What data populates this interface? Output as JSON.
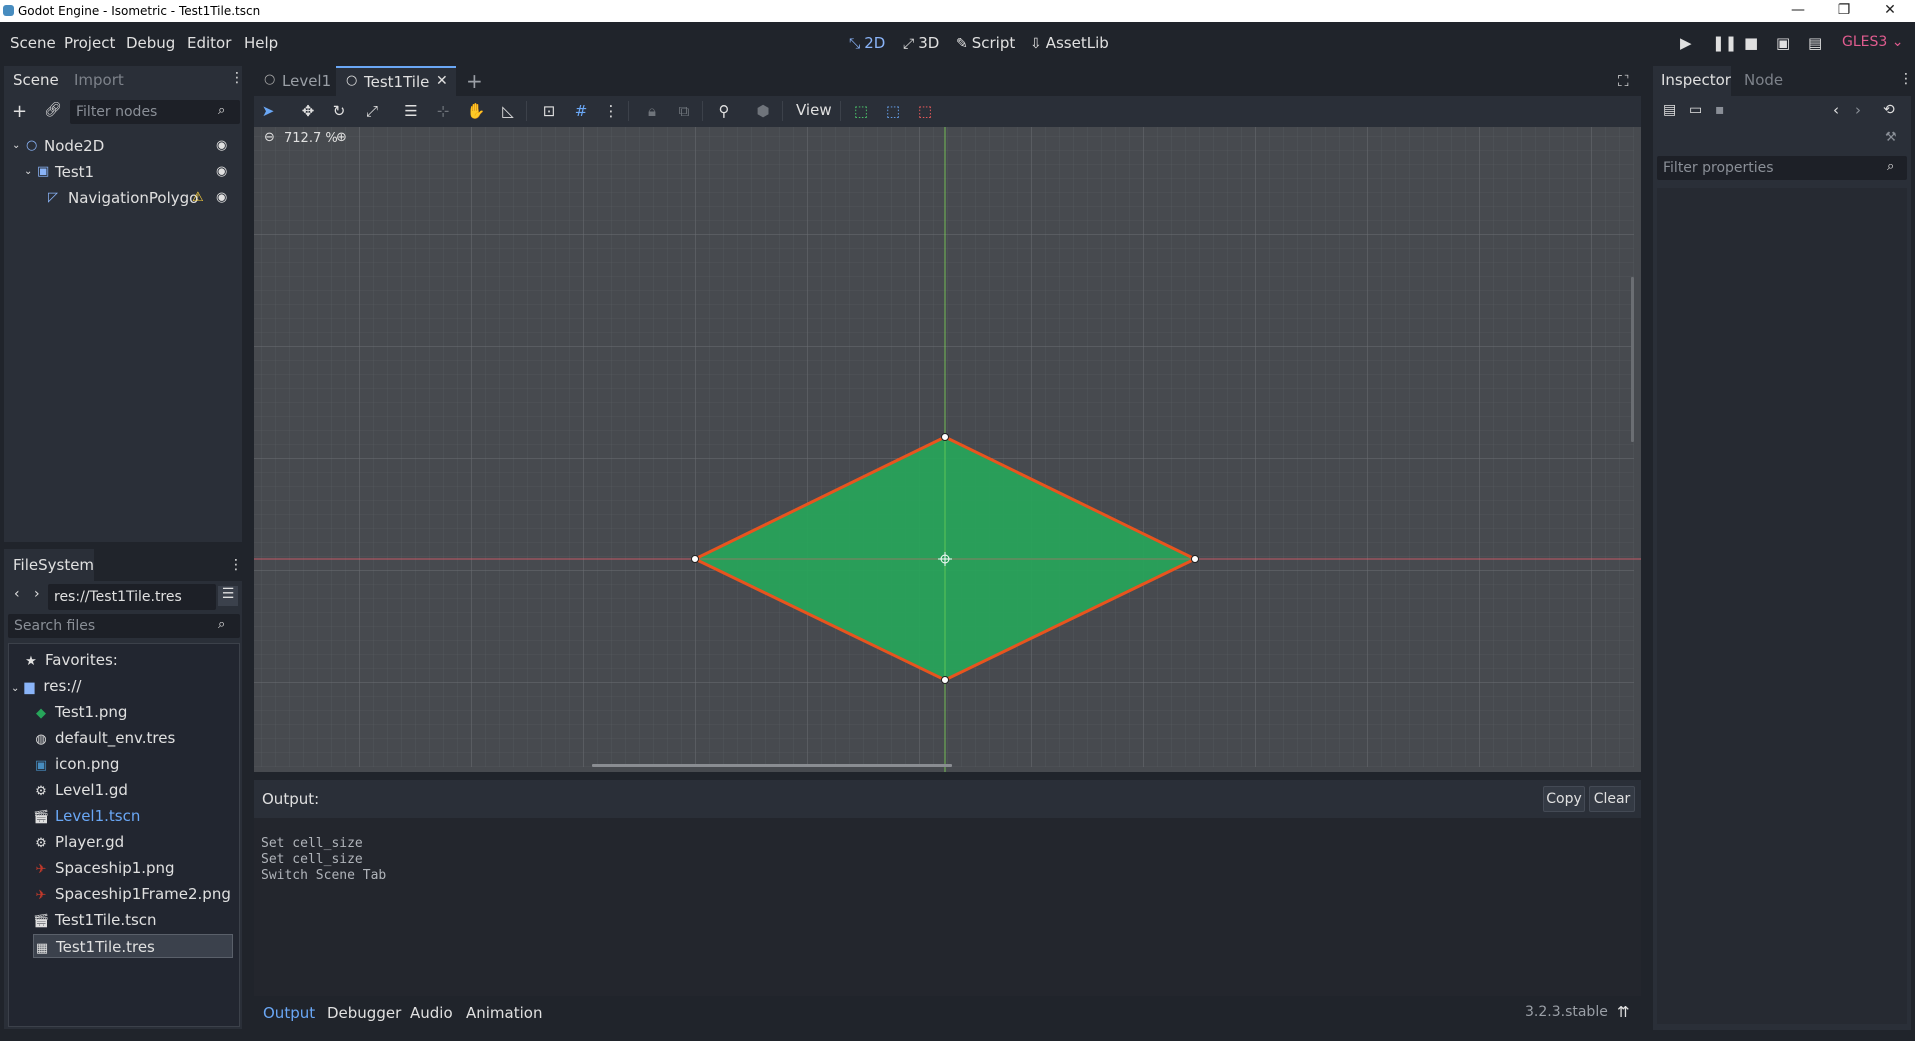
{
  "window": {
    "title": "Godot Engine - Isometric - Test1Tile.tscn",
    "minimize": "—",
    "maximize": "❐",
    "close": "✕"
  },
  "menu": [
    "Scene",
    "Project",
    "Debug",
    "Editor",
    "Help"
  ],
  "workspaces": [
    {
      "label": "2D",
      "icon": "2d-icon"
    },
    {
      "label": "3D",
      "icon": "3d-icon"
    },
    {
      "label": "Script",
      "icon": "script-icon"
    },
    {
      "label": "AssetLib",
      "icon": "assetlib-icon"
    }
  ],
  "renderer": "GLES3",
  "scene_dock": {
    "tabs": [
      "Scene",
      "Import"
    ],
    "filter_placeholder": "Filter nodes",
    "tree": [
      {
        "label": "Node2D",
        "icon": "node2d-icon"
      },
      {
        "label": "Test1",
        "icon": "sprite-icon"
      },
      {
        "label": "NavigationPolygo",
        "icon": "navigation-polygon-icon",
        "warning": true
      }
    ]
  },
  "filesystem": {
    "title": "FileSystem",
    "path": "res://Test1Tile.tres",
    "search_placeholder": "Search files",
    "favorites": "Favorites:",
    "root": "res://",
    "files": [
      {
        "name": "Test1.png",
        "icon": "image-icon",
        "color": "#e0e0e0"
      },
      {
        "name": "default_env.tres",
        "icon": "environment-icon",
        "color": "#e0e0e0"
      },
      {
        "name": "icon.png",
        "icon": "image-icon",
        "color": "#e0e0e0"
      },
      {
        "name": "Level1.gd",
        "icon": "gear-icon",
        "color": "#e0e0e0"
      },
      {
        "name": "Level1.tscn",
        "icon": "scene-icon",
        "color": "#6aa7f5"
      },
      {
        "name": "Player.gd",
        "icon": "gear-icon",
        "color": "#e0e0e0"
      },
      {
        "name": "Spaceship1.png",
        "icon": "image-icon",
        "color": "#e0e0e0"
      },
      {
        "name": "Spaceship1Frame2.png",
        "icon": "image-icon",
        "color": "#e0e0e0"
      },
      {
        "name": "Test1Tile.tscn",
        "icon": "scene-icon",
        "color": "#e0e0e0"
      },
      {
        "name": "Test1Tile.tres",
        "icon": "tileset-icon",
        "color": "#e0e0e0",
        "selected": true
      }
    ]
  },
  "editor_tabs": [
    {
      "label": "Level1",
      "active": false
    },
    {
      "label": "Test1Tile",
      "active": true
    }
  ],
  "toolbar": {
    "view_label": "View"
  },
  "viewport": {
    "zoom": "712.7 %"
  },
  "output": {
    "title": "Output:",
    "copy": "Copy",
    "clear": "Clear",
    "lines": [
      "Set cell_size",
      "Set cell_size",
      "Switch Scene Tab"
    ]
  },
  "bottom_tabs": [
    "Output",
    "Debugger",
    "Audio",
    "Animation"
  ],
  "version": "3.2.3.stable",
  "inspector": {
    "tabs": [
      "Inspector",
      "Node"
    ],
    "filter_placeholder": "Filter properties"
  },
  "colors": {
    "accent": "#6aa7f5",
    "polygon_fill": "#27a55a",
    "polygon_outline": "#e8541e",
    "renderer": "#e05c8f"
  }
}
